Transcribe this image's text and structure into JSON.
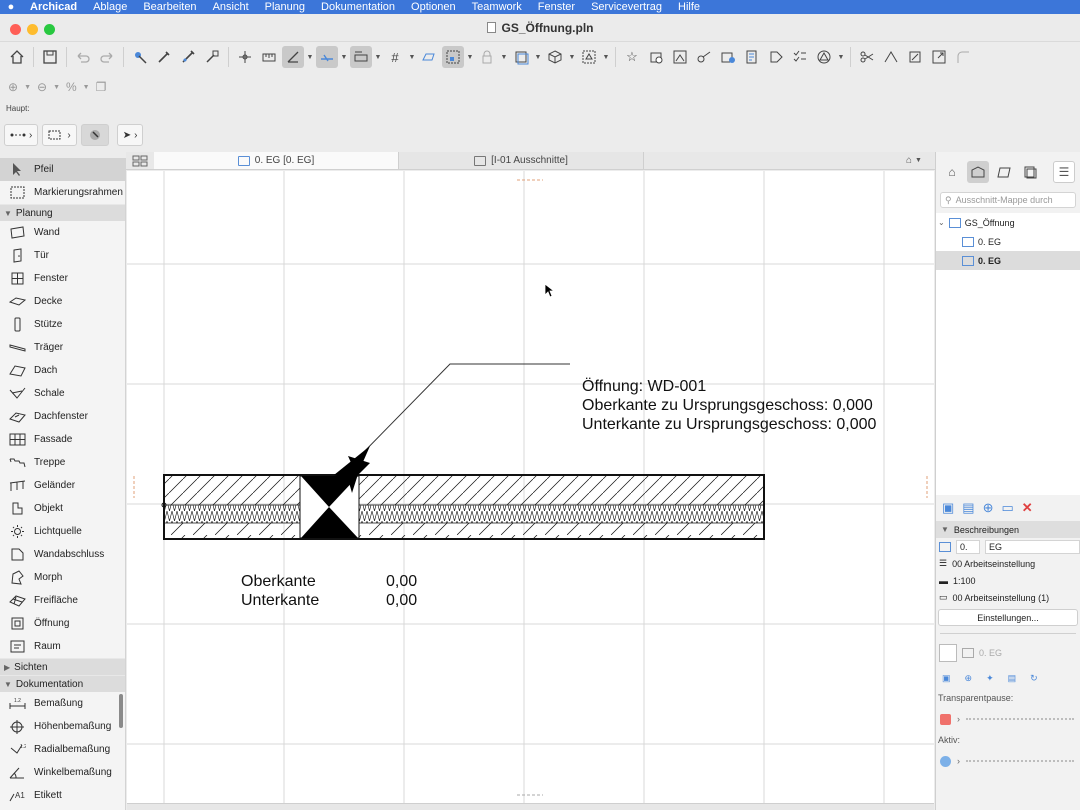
{
  "menubar": {
    "app": "Archicad",
    "items": [
      "Ablage",
      "Bearbeiten",
      "Ansicht",
      "Planung",
      "Dokumentation",
      "Optionen",
      "Teamwork",
      "Fenster",
      "Servicevertrag",
      "Hilfe"
    ]
  },
  "window": {
    "title": "GS_Öffnung.pln"
  },
  "info_box": {
    "label": "Haupt:"
  },
  "toolbox": {
    "top_tools": [
      {
        "label": "Pfeil",
        "icon": "arrow-pointer-icon"
      },
      {
        "label": "Markierungsrahmen",
        "icon": "marquee-icon"
      }
    ],
    "planung": {
      "label": "Planung",
      "tools": [
        {
          "label": "Wand",
          "icon": "wall-icon"
        },
        {
          "label": "Tür",
          "icon": "door-icon"
        },
        {
          "label": "Fenster",
          "icon": "window-icon"
        },
        {
          "label": "Decke",
          "icon": "slab-icon"
        },
        {
          "label": "Stütze",
          "icon": "column-icon"
        },
        {
          "label": "Träger",
          "icon": "beam-icon"
        },
        {
          "label": "Dach",
          "icon": "roof-icon"
        },
        {
          "label": "Schale",
          "icon": "shell-icon"
        },
        {
          "label": "Dachfenster",
          "icon": "skylight-icon"
        },
        {
          "label": "Fassade",
          "icon": "curtain-wall-icon"
        },
        {
          "label": "Treppe",
          "icon": "stair-icon"
        },
        {
          "label": "Geländer",
          "icon": "railing-icon"
        },
        {
          "label": "Objekt",
          "icon": "object-icon"
        },
        {
          "label": "Lichtquelle",
          "icon": "lamp-icon"
        },
        {
          "label": "Wandabschluss",
          "icon": "wall-end-icon"
        },
        {
          "label": "Morph",
          "icon": "morph-icon"
        },
        {
          "label": "Freifläche",
          "icon": "mesh-icon"
        },
        {
          "label": "Öffnung",
          "icon": "opening-icon"
        },
        {
          "label": "Raum",
          "icon": "zone-icon"
        }
      ]
    },
    "sichten": {
      "label": "Sichten"
    },
    "dokumentation": {
      "label": "Dokumentation",
      "tools": [
        {
          "label": "Bemaßung",
          "icon": "dimension-icon"
        },
        {
          "label": "Höhenbemaßung",
          "icon": "level-dimension-icon"
        },
        {
          "label": "Radialbemaßung",
          "icon": "radial-dimension-icon"
        },
        {
          "label": "Winkelbemaßung",
          "icon": "angle-dimension-icon"
        },
        {
          "label": "Etikett",
          "icon": "label-icon"
        }
      ]
    }
  },
  "tabs": [
    {
      "label": "0. EG [0. EG]",
      "active": true
    },
    {
      "label": "[I-01 Ausschnitte]",
      "active": false
    }
  ],
  "drawing": {
    "opening_label": [
      "Öffnung: WD-001",
      "Oberkante zu Ursprungsgeschoss: 0,000",
      "Unterkante zu Ursprungsgeschoss: 0,000"
    ],
    "elevation_rows": [
      {
        "name": "Oberkante",
        "value": "0,00"
      },
      {
        "name": "Unterkante",
        "value": "0,00"
      }
    ]
  },
  "navigator": {
    "search_placeholder": "Ausschnitt-Mappe durch",
    "tree": [
      {
        "label": "GS_Öffnung",
        "level": 0
      },
      {
        "label": "0. EG",
        "level": 1
      },
      {
        "label": "0. EG",
        "level": 1,
        "selected": true
      }
    ],
    "descriptions_header": "Beschreibungen",
    "id_value": "0.",
    "name_value": "EG",
    "layer_combo": "00 Arbeitseinstellung",
    "scale": "1:100",
    "model_view": "00 Arbeitseinstellung (1)",
    "settings_button": "Einstellungen...",
    "preview_label": "0. EG",
    "transparent_label": "Transparentpause:",
    "aktiv_label": "Aktiv:"
  },
  "colors": {
    "menubar": "#3c76d9",
    "accent": "#4a88d9",
    "delete": "#e04040"
  }
}
